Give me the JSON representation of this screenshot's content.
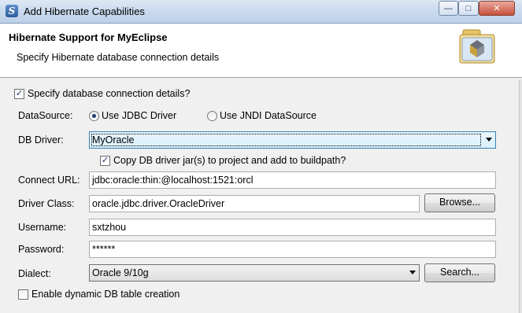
{
  "window": {
    "title": "Add Hibernate Capabilities",
    "app_icon_glyph": "S",
    "controls": {
      "minimize": "—",
      "maximize": "□",
      "close": "✕"
    }
  },
  "header": {
    "title": "Hibernate Support for MyEclipse",
    "subtitle": "Specify Hibernate database connection details",
    "icon": "hibernate-folder-icon"
  },
  "form": {
    "specify_details": {
      "label": "Specify database connection details?",
      "checked": true
    },
    "datasource": {
      "label": "DataSource:",
      "options": [
        {
          "label": "Use JDBC Driver",
          "selected": true
        },
        {
          "label": "Use JNDI DataSource",
          "selected": false
        }
      ]
    },
    "db_driver": {
      "label": "DB Driver:",
      "value": "MyOracle"
    },
    "copy_jars": {
      "label": "Copy DB driver jar(s) to project and add to buildpath?",
      "checked": true
    },
    "connect_url": {
      "label": "Connect URL:",
      "value": "jdbc:oracle:thin:@localhost:1521:orcl"
    },
    "driver_class": {
      "label": "Driver Class:",
      "value": "oracle.jdbc.driver.OracleDriver",
      "button": "Browse..."
    },
    "username": {
      "label": "Username:",
      "value": "sxtzhou"
    },
    "password": {
      "label": "Password:",
      "value": "******"
    },
    "dialect": {
      "label": "Dialect:",
      "value": "Oracle 9/10g",
      "button": "Search..."
    },
    "dynamic_tables": {
      "label": "Enable dynamic DB table creation",
      "checked": false
    }
  },
  "colors": {
    "title_bar": "#c9daee",
    "close_button": "#c7503d",
    "focus_border": "#3c7fb1"
  }
}
